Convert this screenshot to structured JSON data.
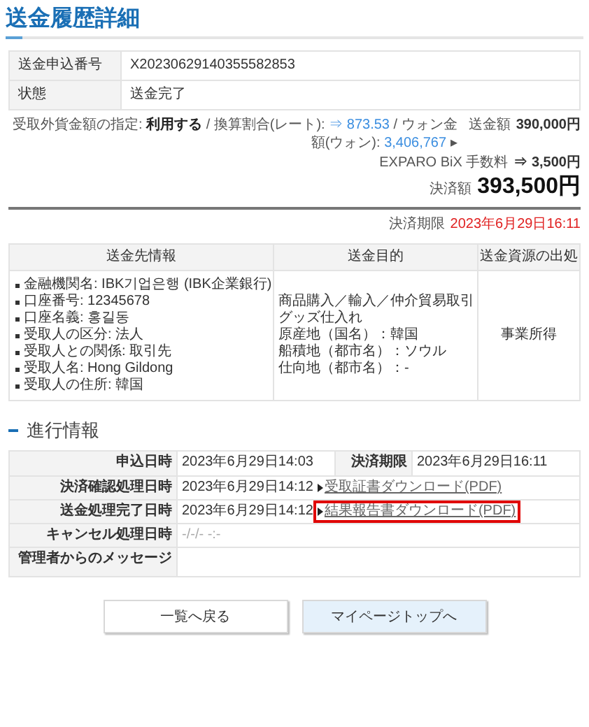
{
  "page_title": "送金履歴詳細",
  "info_rows": [
    {
      "label": "送金申込番号",
      "value": "X20230629140355582853"
    },
    {
      "label": "状態",
      "value": "送金完了"
    }
  ],
  "summary": {
    "segments": [
      {
        "kind": "plain",
        "text": "受取外貨金額の指定: "
      },
      {
        "kind": "bold",
        "text": "利用する"
      },
      {
        "kind": "plain",
        "text": " / 換算割合(レート): "
      },
      {
        "kind": "accent",
        "text": "⇒ 873.53"
      },
      {
        "kind": "plain",
        "text": " / ウォン金額(ウォン): "
      },
      {
        "kind": "accent",
        "text": "3,406,767"
      },
      {
        "kind": "plain",
        "text": " ▸"
      }
    ],
    "remit_label": "送金額",
    "remit_amount": "390,000円",
    "fee_label": "EXPARO BiX 手数料",
    "fee_amount": "⇒ 3,500円",
    "total_label": "決済額",
    "total_amount": "393,500円"
  },
  "deadline": {
    "label": "決済期限",
    "value": "2023年6月29日16:11"
  },
  "recipient_table": {
    "columns": [
      "送金先情報",
      "送金目的",
      "送金資源の出処"
    ],
    "recipient_info": [
      "金融機関名: IBK기업은행 (IBK企業銀行)",
      "口座番号: 12345678",
      "口座名義: 홍길동",
      "受取人の区分: 法人",
      "受取人との関係: 取引先",
      "受取人名: Hong Gildong",
      "受取人の住所: 韓国"
    ],
    "purpose": [
      "商品購入／輸入／仲介貿易取引",
      "グッズ仕入れ",
      "原産地（国名）：韓国",
      "船積地（都市名）：ソウル",
      "仕向地（都市名）：-"
    ],
    "source": "事業所得"
  },
  "progress": {
    "heading": "進行情報",
    "rows": [
      {
        "kind": "pair",
        "label": "申込日時",
        "value": "2023年6月29日14:03",
        "label_2": "決済期限",
        "value_2": "2023年6月29日16:11"
      },
      {
        "kind": "link",
        "label": "決済確認処理日時",
        "value": "2023年6月29日14:12",
        "link": "受取証書ダウンロード(PDF)",
        "highlighted": false
      },
      {
        "kind": "link",
        "label": "送金処理完了日時",
        "value": "2023年6月29日14:12",
        "link": "結果報告書ダウンロード(PDF)",
        "highlighted": true
      },
      {
        "kind": "muted",
        "label": "キャンセル処理日時",
        "value": "-/-/- -:-"
      },
      {
        "kind": "empty",
        "label": "管理者からのメッセージ"
      }
    ]
  },
  "buttons": [
    {
      "label": "一覧へ戻る",
      "primary": false
    },
    {
      "label": "マイページトップへ",
      "primary": true
    }
  ]
}
